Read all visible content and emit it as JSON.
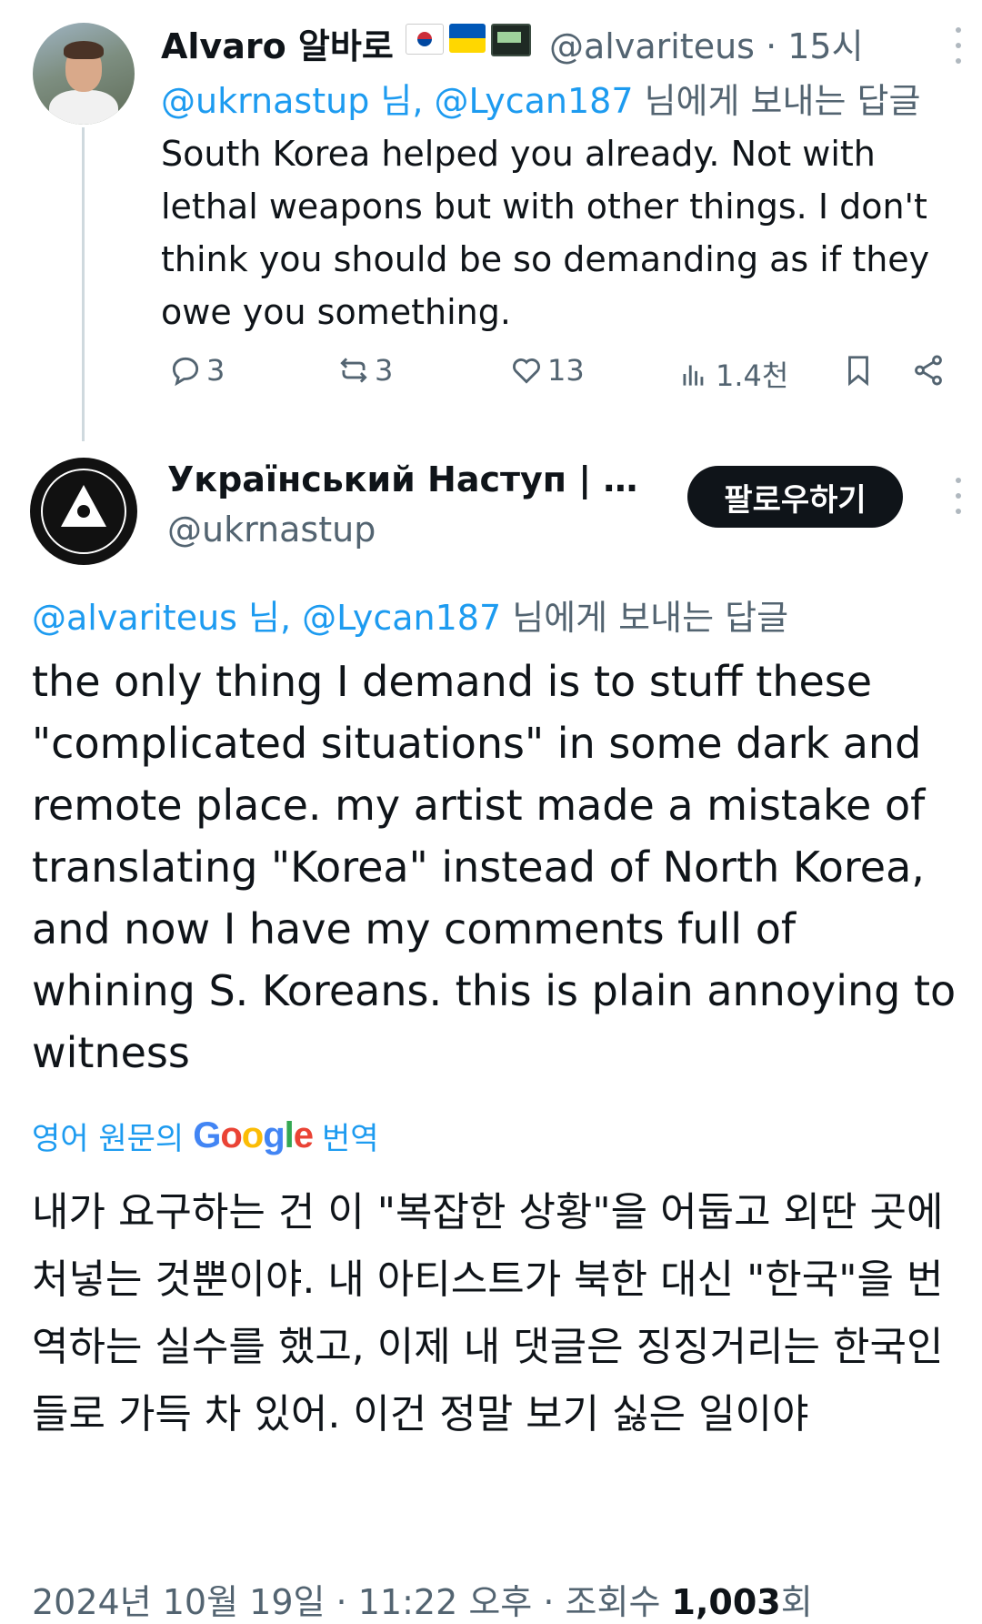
{
  "tweet1": {
    "author_name": "Alvaro 알바로",
    "handle": "@alvariteus",
    "time": "15시",
    "separator": "·",
    "reply_to": {
      "user1": "@ukrnastup",
      "joiner": " 님, ",
      "user2": "@Lycan187",
      "suffix": " 님에게 보내는 답글"
    },
    "text": "South Korea helped you already. Not with lethal weapons but with other things. I don't think you should be so demanding as if they owe you something.",
    "replies": "3",
    "retweets": "3",
    "likes": "13",
    "views": "1.4천",
    "flags": [
      "south-korea-flag",
      "ukraine-flag",
      "pager-emoji"
    ]
  },
  "tweet2": {
    "author_name": "Український Наступ | #Ук...",
    "handle": "@ukrnastup",
    "follow_label": "팔로우하기",
    "reply_to": {
      "user1": "@alvariteus",
      "joiner": " 님, ",
      "user2": "@Lycan187",
      "suffix": " 님에게 보내는 답글"
    },
    "text": "the only thing I demand is to stuff these \"complicated situations\" in some dark and remote place. my artist made a mistake of translating \"Korea\" instead of North Korea, and now I have my comments full of whining S. Koreans. this is plain annoying to witness",
    "translation_prefix": "영어 원문의",
    "translation_brand": [
      "G",
      "o",
      "o",
      "g",
      "l",
      "e"
    ],
    "translation_suffix": "번역",
    "translated_text": "내가 요구하는 건 이 \"복잡한 상황\"을 어둡고 외딴 곳에 처넣는 것뿐이야. 내 아티스트가 북한 대신 \"한국\"을 번역하는 실수를 했고, 이제 내 댓글은 징징거리는 한국인들로 가득 차 있어. 이건 정말 보기 싫은 일이야",
    "date": "2024년 10월 19일",
    "time": "11:22 오후",
    "views_label": "조회수",
    "views": "1,003",
    "views_suffix": "회",
    "separator": "·"
  },
  "colors": {
    "link": "#1d9bf0",
    "secondary_text": "#536471",
    "primary_text": "#0f1419",
    "follow_button_bg": "#0f1419"
  }
}
